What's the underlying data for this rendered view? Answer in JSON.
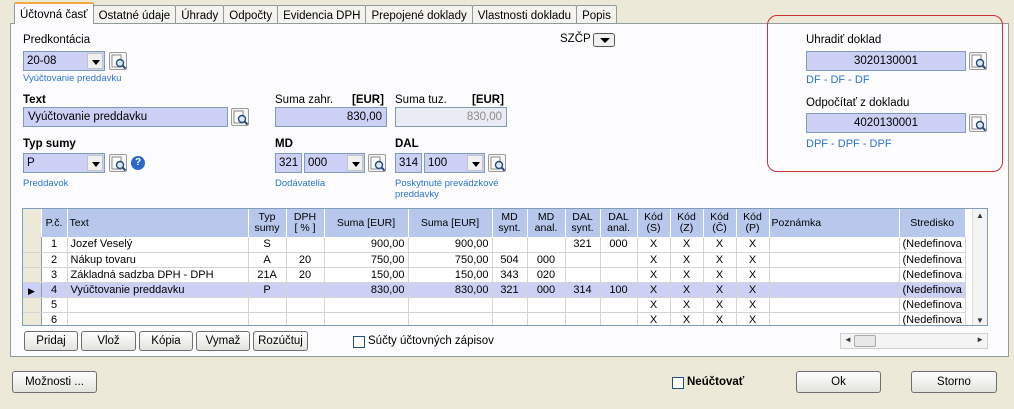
{
  "tabs": [
    "Účtovná časť",
    "Ostatné údaje",
    "Úhrady",
    "Odpočty",
    "Evidencia DPH",
    "Prepojené doklady",
    "Vlastnosti dokladu",
    "Popis"
  ],
  "predkontacia": {
    "label": "Predkontácia",
    "value": "20-08",
    "hint": "Vyúčtovanie preddavku"
  },
  "szcp_label": "SZČP",
  "text": {
    "label": "Text",
    "value": "Vyúčtovanie preddavku"
  },
  "suma_zahr": {
    "label": "Suma zahr.",
    "currency": "[EUR]",
    "value": "830,00"
  },
  "suma_tuz": {
    "label": "Suma tuz.",
    "currency": "[EUR]",
    "value": "830,00"
  },
  "typ_sumy": {
    "label": "Typ sumy",
    "value": "P",
    "hint": "Preddavok"
  },
  "md": {
    "label": "MD",
    "synt": "321",
    "anal": "000",
    "hint": "Dodávatelia"
  },
  "dal": {
    "label": "DAL",
    "synt": "314",
    "anal": "100",
    "hint_line1": "Poskytnuté prevádzkové",
    "hint_line2": "preddavky"
  },
  "uhradit": {
    "label": "Uhradiť doklad",
    "value": "3020130001",
    "hint": "DF - DF - DF"
  },
  "odpocitat": {
    "label": "Odpočítať z dokladu",
    "value": "4020130001",
    "hint": "DPF - DPF - DPF"
  },
  "grid": {
    "headers": [
      [
        "P.č.",
        ""
      ],
      [
        "Text",
        ""
      ],
      [
        "Typ",
        "sumy"
      ],
      [
        "DPH",
        "[ % ]"
      ],
      [
        "Suma [EUR]",
        ""
      ],
      [
        "Suma [EUR]",
        ""
      ],
      [
        "MD",
        "synt."
      ],
      [
        "MD",
        "anal."
      ],
      [
        "DAL",
        "synt."
      ],
      [
        "DAL",
        "anal."
      ],
      [
        "Kód",
        "(S)"
      ],
      [
        "Kód",
        "(Z)"
      ],
      [
        "Kód",
        "(Č)"
      ],
      [
        "Kód",
        "(P)"
      ],
      [
        "Poznámka",
        ""
      ],
      [
        "Stredisko",
        ""
      ]
    ],
    "rows": [
      [
        "1",
        "Jozef Veselý",
        "S",
        "",
        "900,00",
        "900,00",
        "",
        "",
        "321",
        "000",
        "X",
        "X",
        "X",
        "X",
        "",
        "(Nedefinova"
      ],
      [
        "2",
        "Nákup tovaru",
        "A",
        "20",
        "750,00",
        "750,00",
        "504",
        "000",
        "",
        "",
        "X",
        "X",
        "X",
        "X",
        "",
        "(Nedefinova"
      ],
      [
        "3",
        "Základná sadzba DPH - DPH",
        "21A",
        "20",
        "150,00",
        "150,00",
        "343",
        "020",
        "",
        "",
        "X",
        "X",
        "X",
        "X",
        "",
        "(Nedefinova"
      ],
      [
        "4",
        "Vyúčtovanie preddavku",
        "P",
        "",
        "830,00",
        "830,00",
        "321",
        "000",
        "314",
        "100",
        "X",
        "X",
        "X",
        "X",
        "",
        "(Nedefinova"
      ],
      [
        "5",
        "",
        "",
        "",
        "",
        "",
        "",
        "",
        "",
        "",
        "X",
        "X",
        "X",
        "X",
        "",
        "(Nedefinova"
      ],
      [
        "6",
        "",
        "",
        "",
        "",
        "",
        "",
        "",
        "",
        "",
        "X",
        "X",
        "X",
        "X",
        "",
        "(Nedefinova"
      ]
    ],
    "selected_row": 3
  },
  "buttons": {
    "pridaj": "Pridaj",
    "vloz": "Vlož",
    "kopia": "Kópia",
    "vymaz": "Vymaž",
    "rozuctuj": "Rozúčtuj",
    "moznosti": "Možnosti ...",
    "ok": "Ok",
    "storno": "Storno"
  },
  "sucty_label": "Súčty účtovných zápisov",
  "neuctovat_label": "Neúčtovať",
  "colors": {
    "field_bg": "#cdd0f5",
    "highlight": "#c83232",
    "hint": "#2c73c9",
    "header_bg": "#b8c8ec"
  },
  "icons": {
    "lookup": "magnifier-document-icon",
    "help": "help-icon",
    "dropdown": "chevron-down-icon"
  }
}
